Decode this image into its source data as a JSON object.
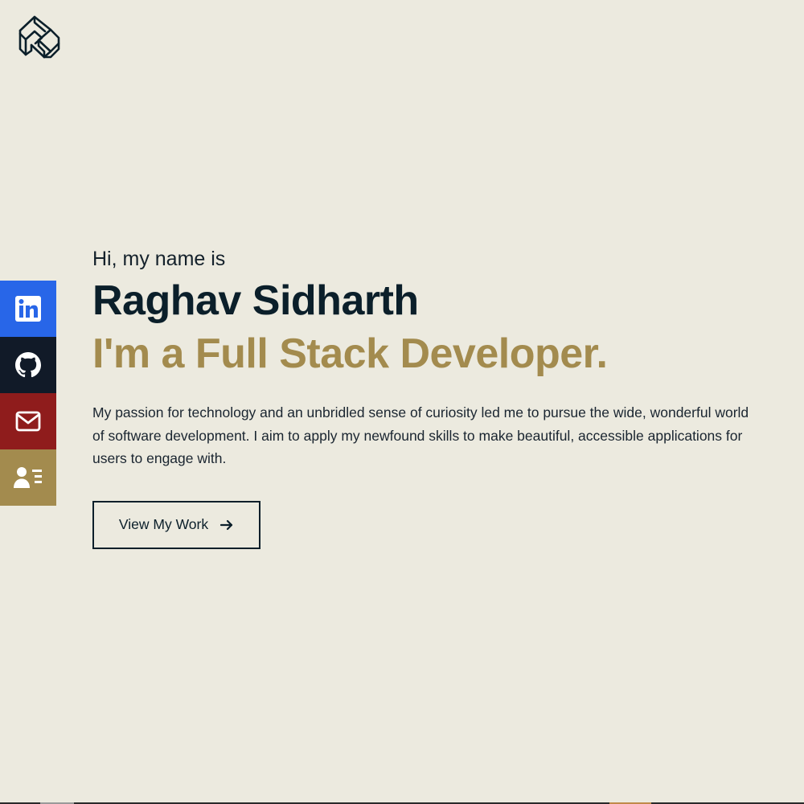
{
  "brand": {
    "logo_icon": "monogram-r-logo-icon"
  },
  "social": {
    "items": [
      {
        "name": "linkedin",
        "icon": "linkedin-icon",
        "color": "#2866e8"
      },
      {
        "name": "github",
        "icon": "github-icon",
        "color": "#111a28"
      },
      {
        "name": "email",
        "icon": "mail-icon",
        "color": "#8f1c1c"
      },
      {
        "name": "resume",
        "icon": "contact-card-icon",
        "color": "#a38b4e"
      }
    ]
  },
  "hero": {
    "greeting": "Hi, my name is",
    "name": "Raghav Sidharth",
    "role": "I'm a Full Stack Developer.",
    "bio": "My passion for technology and an unbridled sense of curiosity led me to pursue the wide, wonderful world of software development. I aim to apply my newfound skills to make beautiful, accessible applications for users to engage with.",
    "cta_label": "View My Work",
    "cta_icon": "arrow-right-icon"
  },
  "colors": {
    "background": "#eceadf",
    "primary_text": "#0b1f2a",
    "accent": "#a38b4e"
  }
}
